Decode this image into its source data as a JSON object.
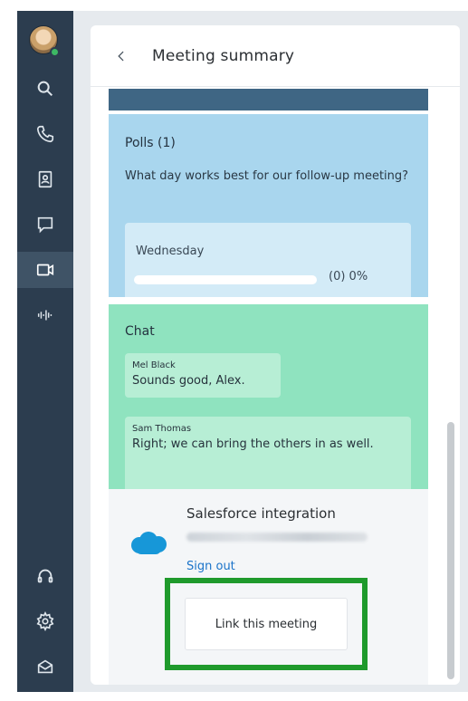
{
  "header": {
    "title": "Meeting summary"
  },
  "polls": {
    "title": "Polls (1)",
    "question": "What day works best for our follow-up meeting?",
    "options": [
      {
        "label": "Wednesday",
        "count_text": "(0) 0%",
        "percent": 0
      }
    ]
  },
  "chat": {
    "title": "Chat",
    "messages": [
      {
        "sender": "Mel Black",
        "text": "Sounds good, Alex."
      },
      {
        "sender": "Sam Thomas",
        "text": "Right; we can bring the others in as well."
      }
    ]
  },
  "salesforce": {
    "title": "Salesforce integration",
    "sign_out_label": "Sign out",
    "link_button_label": "Link this meeting"
  },
  "colors": {
    "sidebar": "#2c3d4f",
    "polls_bg": "#a9d6ee",
    "chat_bg": "#8fe3bf",
    "highlight": "#1f9a2c",
    "link": "#1a73c9"
  },
  "icons": {
    "nav": [
      "search-icon",
      "phone-icon",
      "contacts-icon",
      "chat-icon",
      "video-icon",
      "voicemail-icon"
    ],
    "bottom": [
      "headset-icon",
      "gear-icon",
      "apps-icon"
    ]
  }
}
